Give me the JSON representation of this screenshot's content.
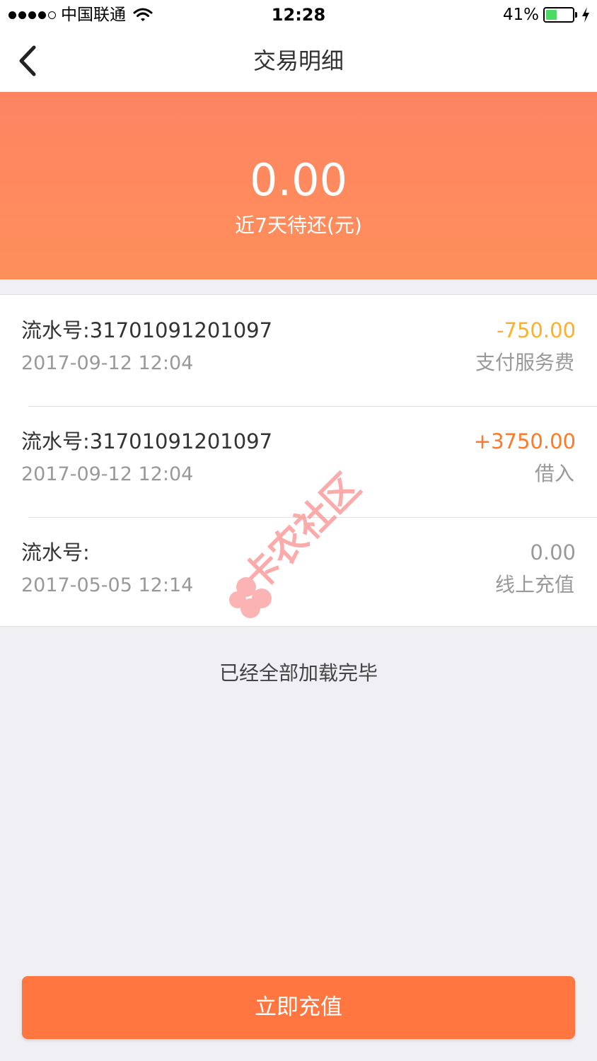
{
  "status_bar": {
    "carrier": "中国联通",
    "time": "12:28",
    "battery_percent": "41%",
    "battery_level": 0.41,
    "signal_bars_filled": 4,
    "signal_bars_total": 5,
    "icons": [
      "wifi-icon",
      "battery-icon",
      "charging-bolt-icon"
    ]
  },
  "nav": {
    "title": "交易明细",
    "back_icon": "chevron-left-icon"
  },
  "summary": {
    "amount": "0.00",
    "label": "近7天待还(元)"
  },
  "transactions": [
    {
      "serial_label": "流水号:31701091201097",
      "date": "2017-09-12 12:04",
      "amount": "-750.00",
      "amount_color": "#fdb02c",
      "type": "支付服务费"
    },
    {
      "serial_label": "流水号:31701091201097",
      "date": "2017-09-12 12:04",
      "amount": "+3750.00",
      "amount_color": "#fb7a2c",
      "type": "借入"
    },
    {
      "serial_label": "流水号:",
      "date": "2017-05-05 12:14",
      "amount": "0.00",
      "amount_color": "#999999",
      "type": "线上充值"
    }
  ],
  "list_end_text": "已经全部加载完毕",
  "recharge_button": {
    "label": "立即充值"
  },
  "watermark": {
    "text": "卡农社区"
  },
  "colors": {
    "hero_gradient_top": "#fe8462",
    "hero_gradient_bottom": "#fe8f5b",
    "primary_button": "#ff7640",
    "page_background": "#efeff4"
  }
}
